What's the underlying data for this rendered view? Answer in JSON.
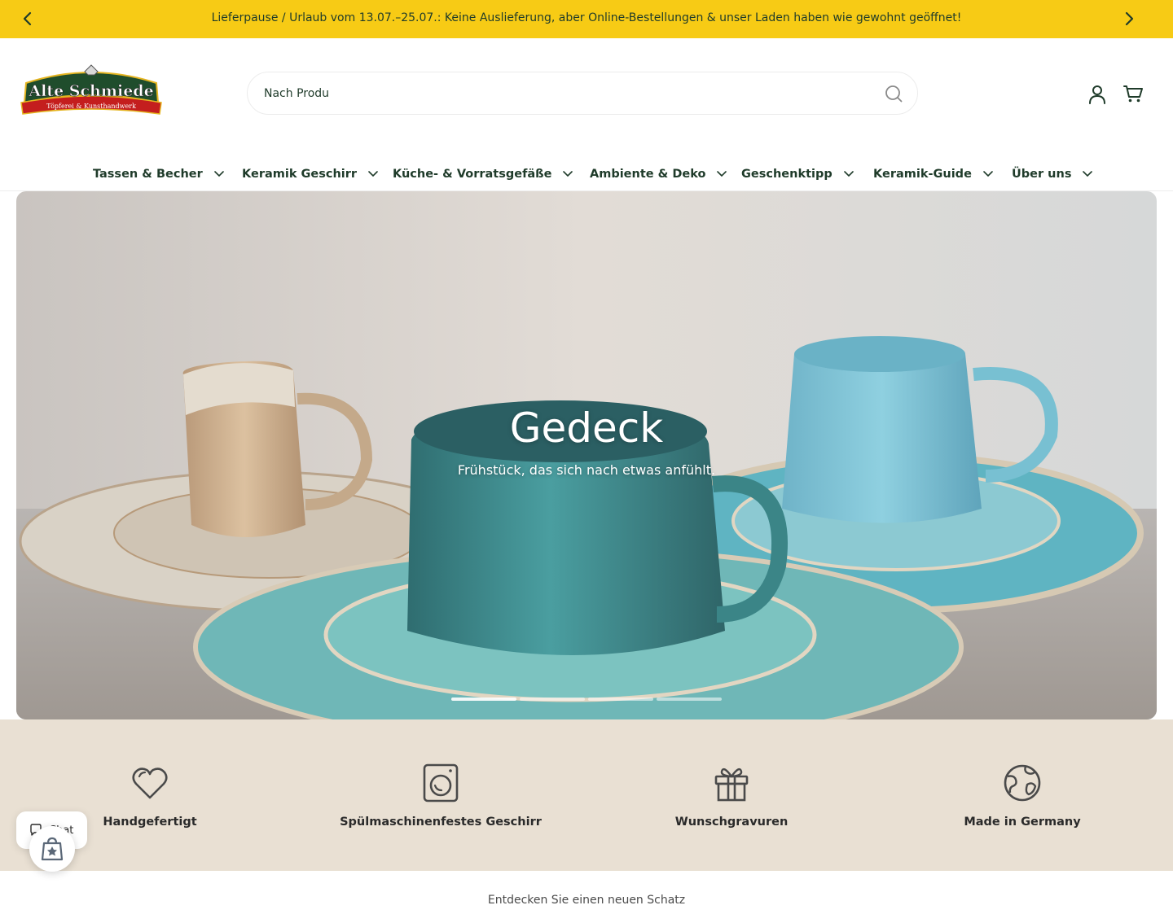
{
  "announcement": {
    "text": "Lieferpause / Urlaub vom 13.07.–25.07.: Keine Auslieferung, aber Online-Bestellungen & unser Laden haben wie gewohnt geöffnet!",
    "prev_icon": "chevron-left-icon",
    "next_icon": "chevron-right-icon",
    "background": "#f7cb15"
  },
  "header": {
    "logo_text": "Alte Schmiede",
    "logo_subtext": "Töpferei & Kunsthandwerk",
    "search_value": "Nach Produ",
    "search_icon": "search-icon",
    "account_icon": "user-icon",
    "cart_icon": "cart-icon"
  },
  "nav": {
    "items": [
      {
        "label": "Tassen & Becher"
      },
      {
        "label": "Keramik Geschirr"
      },
      {
        "label": "Küche- & Vorratsgefäße"
      },
      {
        "label": "Ambiente & Deko"
      },
      {
        "label": "Geschenktipp"
      },
      {
        "label": "Keramik-Guide"
      },
      {
        "label": "Über uns"
      }
    ],
    "text_color": "#1f3b2a"
  },
  "hero": {
    "title": "Gedeck",
    "subtitle": "Frühstück, das sich nach etwas anfühlt.",
    "slides_count": 4,
    "active_slide": 1
  },
  "features": {
    "background": "#e9e0d3",
    "items": [
      {
        "label": "Handgefertigt",
        "icon": "heart-icon"
      },
      {
        "label": "Spülmaschinenfestes Geschirr",
        "icon": "washing-machine-icon"
      },
      {
        "label": "Wunschgravuren",
        "icon": "gift-icon"
      },
      {
        "label": "Made in Germany",
        "icon": "globe-icon"
      }
    ]
  },
  "chat": {
    "label": "Chat",
    "icon": "chat-bubble-icon",
    "badge_icon": "shopping-bag-badge-icon"
  },
  "section": {
    "heading": "Entdecken Sie einen neuen Schatz"
  }
}
